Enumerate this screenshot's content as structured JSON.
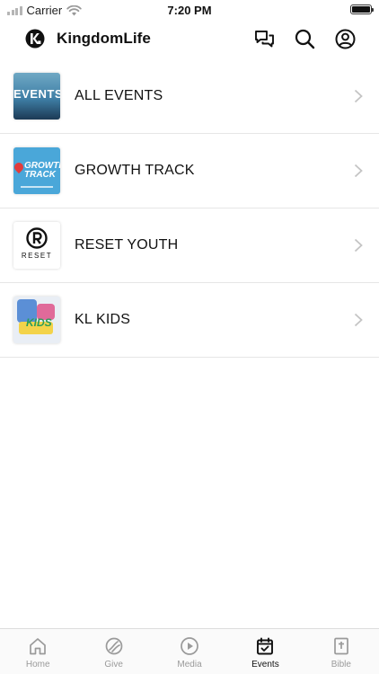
{
  "status_bar": {
    "carrier": "Carrier",
    "time": "7:20 PM"
  },
  "header": {
    "app_title": "KingdomLife",
    "logo_icon": "kl-logo-icon",
    "actions": [
      {
        "icon": "chat-icon"
      },
      {
        "icon": "search-icon"
      },
      {
        "icon": "profile-icon"
      }
    ]
  },
  "events": [
    {
      "label": "ALL EVENTS",
      "thumb_text": "EVENTS"
    },
    {
      "label": "GROWTH TRACK",
      "thumb_text_1": "GROWTH",
      "thumb_text_2": "TRACK"
    },
    {
      "label": "RESET YOUTH",
      "thumb_text": "RESET"
    },
    {
      "label": "KL KIDS",
      "thumb_text": "KIDS"
    }
  ],
  "tabbar": {
    "tabs": [
      {
        "label": "Home",
        "icon": "home-icon",
        "active": false
      },
      {
        "label": "Give",
        "icon": "give-icon",
        "active": false
      },
      {
        "label": "Media",
        "icon": "play-icon",
        "active": false
      },
      {
        "label": "Events",
        "icon": "calendar-icon",
        "active": true
      },
      {
        "label": "Bible",
        "icon": "bible-icon",
        "active": false
      }
    ]
  },
  "colors": {
    "active_tab": "#111111",
    "inactive_tab": "#9a9a9a",
    "divider": "#e6e6e6"
  }
}
